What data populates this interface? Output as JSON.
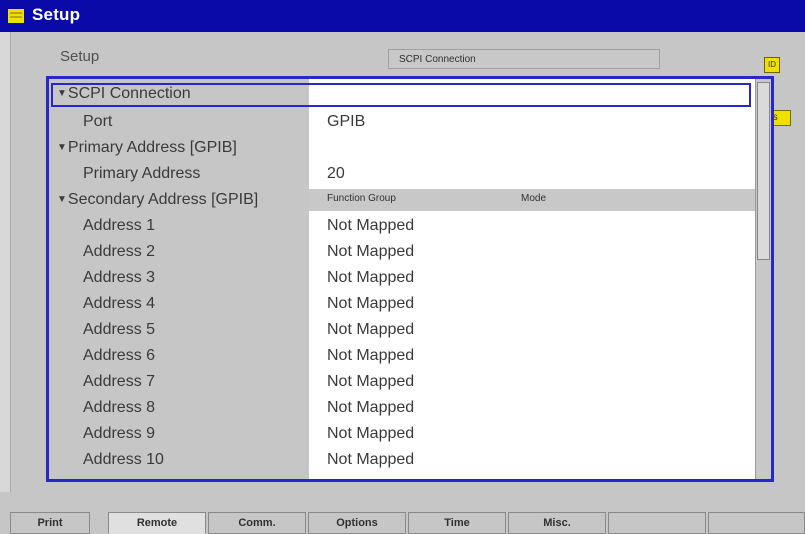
{
  "window": {
    "title": "Setup"
  },
  "header": {
    "setup_label": "Setup",
    "connection_box": "SCPI Connection",
    "corner_badge": "ID",
    "compress_button": "Compress"
  },
  "tree": {
    "scpi_connection": {
      "label": "SCPI Connection",
      "expanded": true
    },
    "port": {
      "label": "Port",
      "value": "GPIB"
    },
    "primary_address_group": {
      "label": "Primary Address [GPIB]",
      "expanded": true
    },
    "primary_address": {
      "label": "Primary Address",
      "value": "20"
    },
    "secondary_address_group": {
      "label": "Secondary Address [GPIB]",
      "expanded": true
    },
    "columns": {
      "function_group": "Function Group",
      "mode": "Mode"
    },
    "addresses": [
      {
        "label": "Address 1",
        "value": "Not Mapped"
      },
      {
        "label": "Address 2",
        "value": "Not Mapped"
      },
      {
        "label": "Address 3",
        "value": "Not Mapped"
      },
      {
        "label": "Address 4",
        "value": "Not Mapped"
      },
      {
        "label": "Address 5",
        "value": "Not Mapped"
      },
      {
        "label": "Address 6",
        "value": "Not Mapped"
      },
      {
        "label": "Address 7",
        "value": "Not Mapped"
      },
      {
        "label": "Address 8",
        "value": "Not Mapped"
      },
      {
        "label": "Address 9",
        "value": "Not Mapped"
      },
      {
        "label": "Address 10",
        "value": "Not Mapped"
      }
    ]
  },
  "tabs": [
    {
      "label": "Print",
      "active": false
    },
    {
      "label": "Remote",
      "active": true
    },
    {
      "label": "Comm.",
      "active": false
    },
    {
      "label": "Options",
      "active": false
    },
    {
      "label": "Time",
      "active": false
    },
    {
      "label": "Misc.",
      "active": false
    },
    {
      "label": "",
      "active": false
    },
    {
      "label": "",
      "active": false
    }
  ],
  "colors": {
    "titlebar": "#0a0aa8",
    "selection_border": "#2828c8",
    "highlight_yellow": "#f0e000",
    "panel_gray": "#c6c6c6"
  }
}
